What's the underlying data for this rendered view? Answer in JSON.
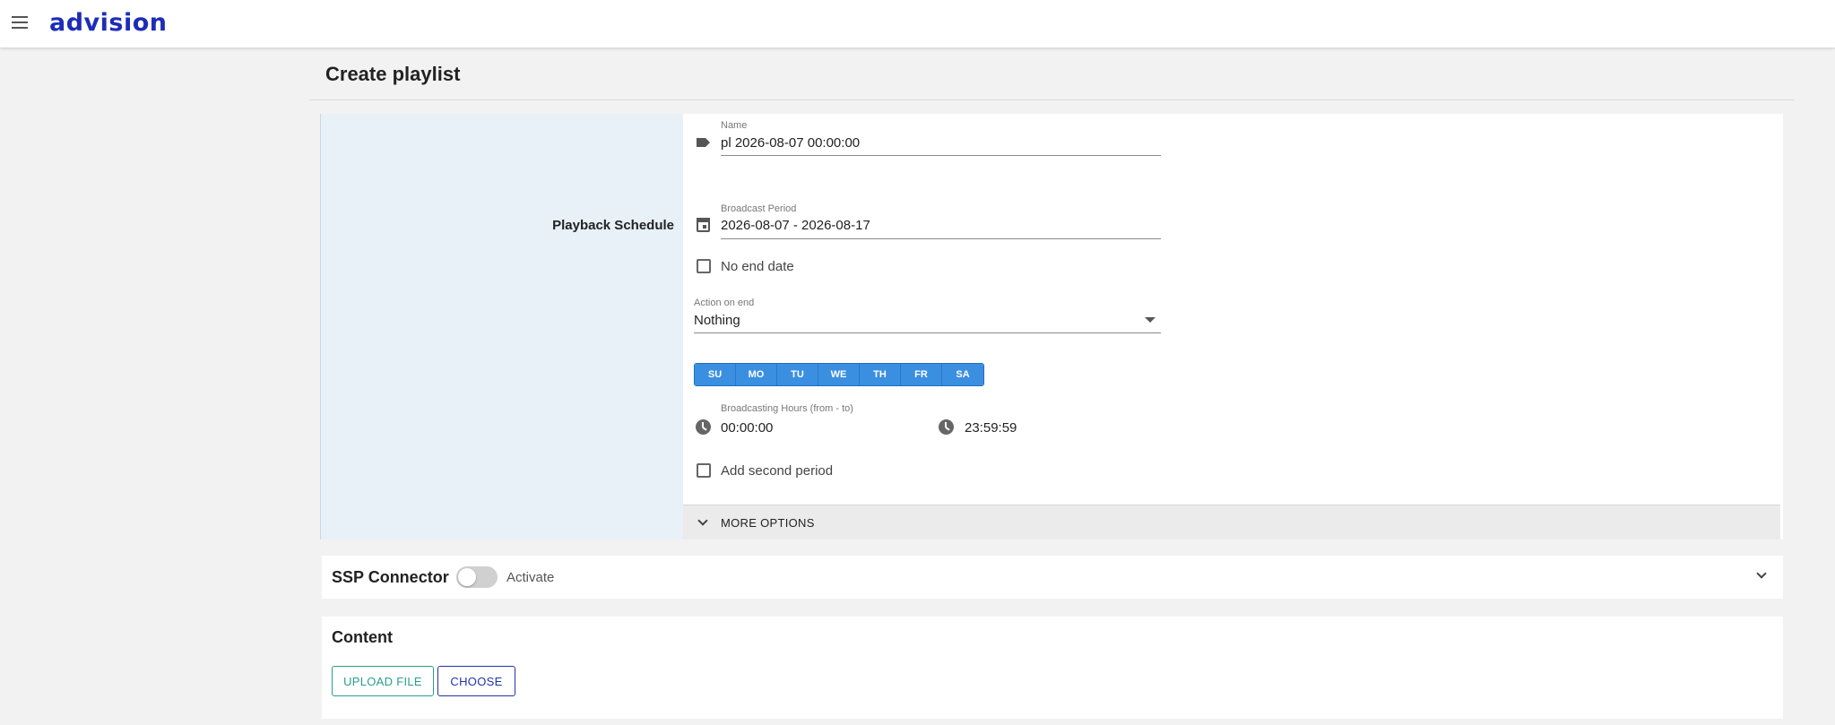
{
  "app": {
    "logo": "advision"
  },
  "page": {
    "title": "Create playlist"
  },
  "schedule": {
    "section_label": "Playback Schedule",
    "name": {
      "label": "Name",
      "value": "pl 2026-08-07 00:00:00"
    },
    "broadcast_period": {
      "label": "Broadcast Period",
      "value": "2026-08-07 - 2026-08-17"
    },
    "no_end_date": {
      "label": "No end date",
      "checked": false
    },
    "action_on_end": {
      "label": "Action on end",
      "value": "Nothing"
    },
    "days": [
      "SU",
      "MO",
      "TU",
      "WE",
      "TH",
      "FR",
      "SA"
    ],
    "broadcasting_hours": {
      "label": "Broadcasting Hours (from - to)",
      "from": "00:00:00",
      "to": "23:59:59"
    },
    "add_second_period": {
      "label": "Add second period",
      "checked": false
    },
    "more_options_label": "MORE OPTIONS"
  },
  "ssp": {
    "title": "SSP Connector",
    "toggle_label": "Activate",
    "active": false
  },
  "content": {
    "title": "Content",
    "upload_label": "UPLOAD FILE",
    "choose_label": "CHOOSE"
  },
  "colors": {
    "brand": "#1d2db8",
    "day_active": "#3b8fe0",
    "upload_accent": "#2a9d8f",
    "choose_accent": "#2233aa"
  }
}
